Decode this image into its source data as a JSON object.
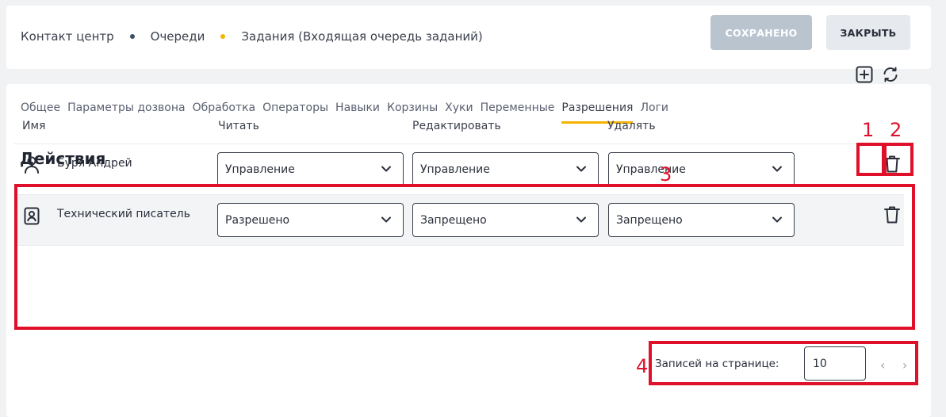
{
  "breadcrumb": {
    "items": [
      "Контакт центр",
      "Очереди",
      "Задания (Входящая очередь заданий)"
    ],
    "dot_colors": [
      "#3d4f66",
      "#f5b300"
    ]
  },
  "header_buttons": {
    "saved": "СОХРАНЕНО",
    "close": "ЗАКРЫТЬ"
  },
  "tabs": [
    "Общее",
    "Параметры дозвона",
    "Обработка",
    "Операторы",
    "Навыки",
    "Корзины",
    "Хуки",
    "Переменные",
    "Разрешения",
    "Логи"
  ],
  "active_tab": "Разрешения",
  "section": {
    "title": "Действия"
  },
  "table": {
    "columns": [
      "Имя",
      "Читать",
      "Редактировать",
      "Удалять"
    ],
    "rows": [
      {
        "name": "Буря Андрей",
        "icon": "person-icon",
        "read": "Управление",
        "edit": "Управление",
        "delete": "Управление"
      },
      {
        "name": "Технический писатель",
        "icon": "badge-icon",
        "read": "Разрешено",
        "edit": "Запрещено",
        "delete": "Запрещено"
      }
    ]
  },
  "pagination": {
    "label": "Записей на странице:",
    "value": "10"
  },
  "annotations": [
    "1",
    "2",
    "3",
    "4"
  ],
  "colors": {
    "accent": "#f5b300",
    "annotation": "#e0102a",
    "saved_button": "#b9c4cf"
  }
}
